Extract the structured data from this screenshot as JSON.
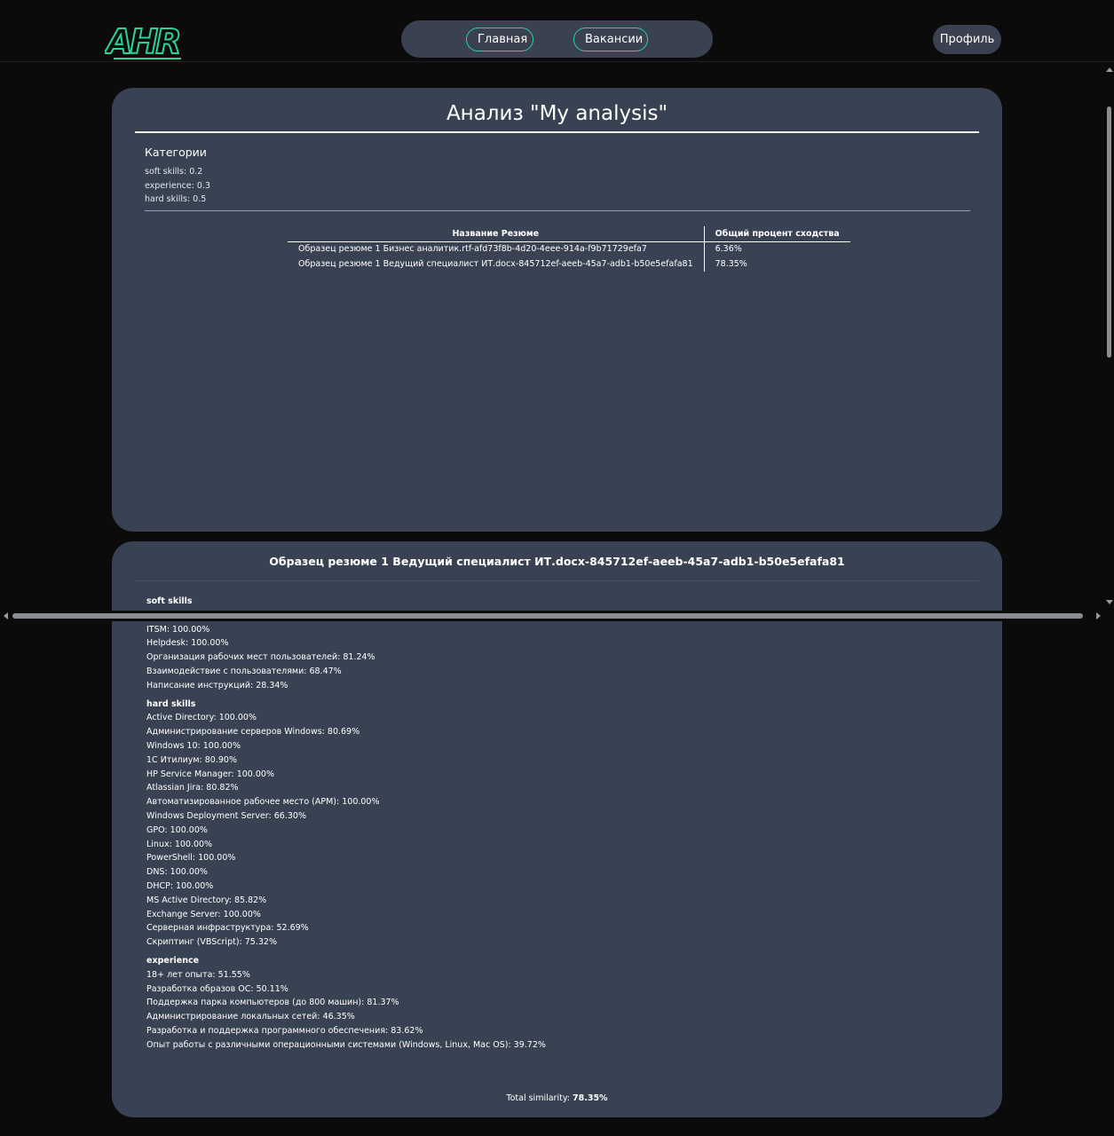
{
  "header": {
    "logo_text": "AHR",
    "nav": {
      "home_label": "Главная",
      "vacancies_label": "Вакансии"
    },
    "profile_label": "Профиль"
  },
  "analysis": {
    "title": "Анализ \"My analysis\"",
    "categories_heading": "Категории",
    "categories": [
      "soft skills: 0.2",
      "experience: 0.3",
      "hard skills: 0.5"
    ],
    "table": {
      "headers": [
        "Название Резюме",
        "Общий процент сходства"
      ],
      "rows": [
        [
          "Образец резюме 1 Бизнес аналитик.rtf-afd73f8b-4d20-4eee-914a-f9b71729efa7",
          "6.36%"
        ],
        [
          "Образец резюме 1 Ведущий специалист ИТ.docx-845712ef-aeeb-45a7-adb1-b50e5efafa81",
          "78.35%"
        ]
      ]
    }
  },
  "detail": {
    "title": "Образец резюме 1 Ведущий специалист ИТ.docx-845712ef-aeeb-45a7-adb1-b50e5efafa81",
    "soft_heading": "soft skills",
    "soft_items": [
      "ITSM: 100.00%",
      "Helpdesk: 100.00%",
      "Организация рабочих мест пользователей: 81.24%",
      "Взаимодействие с пользователями: 68.47%",
      "Написание инструкций: 28.34%"
    ],
    "hard_heading": "hard skills",
    "hard_items": [
      "Active Directory: 100.00%",
      "Администрирование серверов Windows: 80.69%",
      "Windows 10: 100.00%",
      "1С Итилиум: 80.90%",
      "HP Service Manager: 100.00%",
      "Atlassian Jira: 80.82%",
      "Автоматизированное рабочее место (АРМ): 100.00%",
      "Windows Deployment Server: 66.30%",
      "GPO: 100.00%",
      "Linux: 100.00%",
      "PowerShell: 100.00%",
      "DNS: 100.00%",
      "DHCP: 100.00%",
      "MS Active Directory: 85.82%",
      "Exchange Server: 100.00%",
      "Серверная инфраструктура: 52.69%",
      "Скриптинг (VBScript): 75.32%"
    ],
    "exp_heading": "experience",
    "exp_items": [
      "18+ лет опыта: 51.55%",
      "Разработка образов ОС: 50.11%",
      "Поддержка парка компьютеров (до 800 машин): 81.37%",
      "Администрирование локальных сетей: 46.35%",
      "Разработка и поддержка программного обеспечения: 83.62%",
      "Опыт работы с различными операционными системами (Windows, Linux, Mac OS): 39.72%"
    ],
    "total_label": "Total similarity:",
    "total_value": "78.35%"
  },
  "colors": {
    "background": "#0b0b0b",
    "card": "#394252",
    "accent": "#2bd39a"
  }
}
